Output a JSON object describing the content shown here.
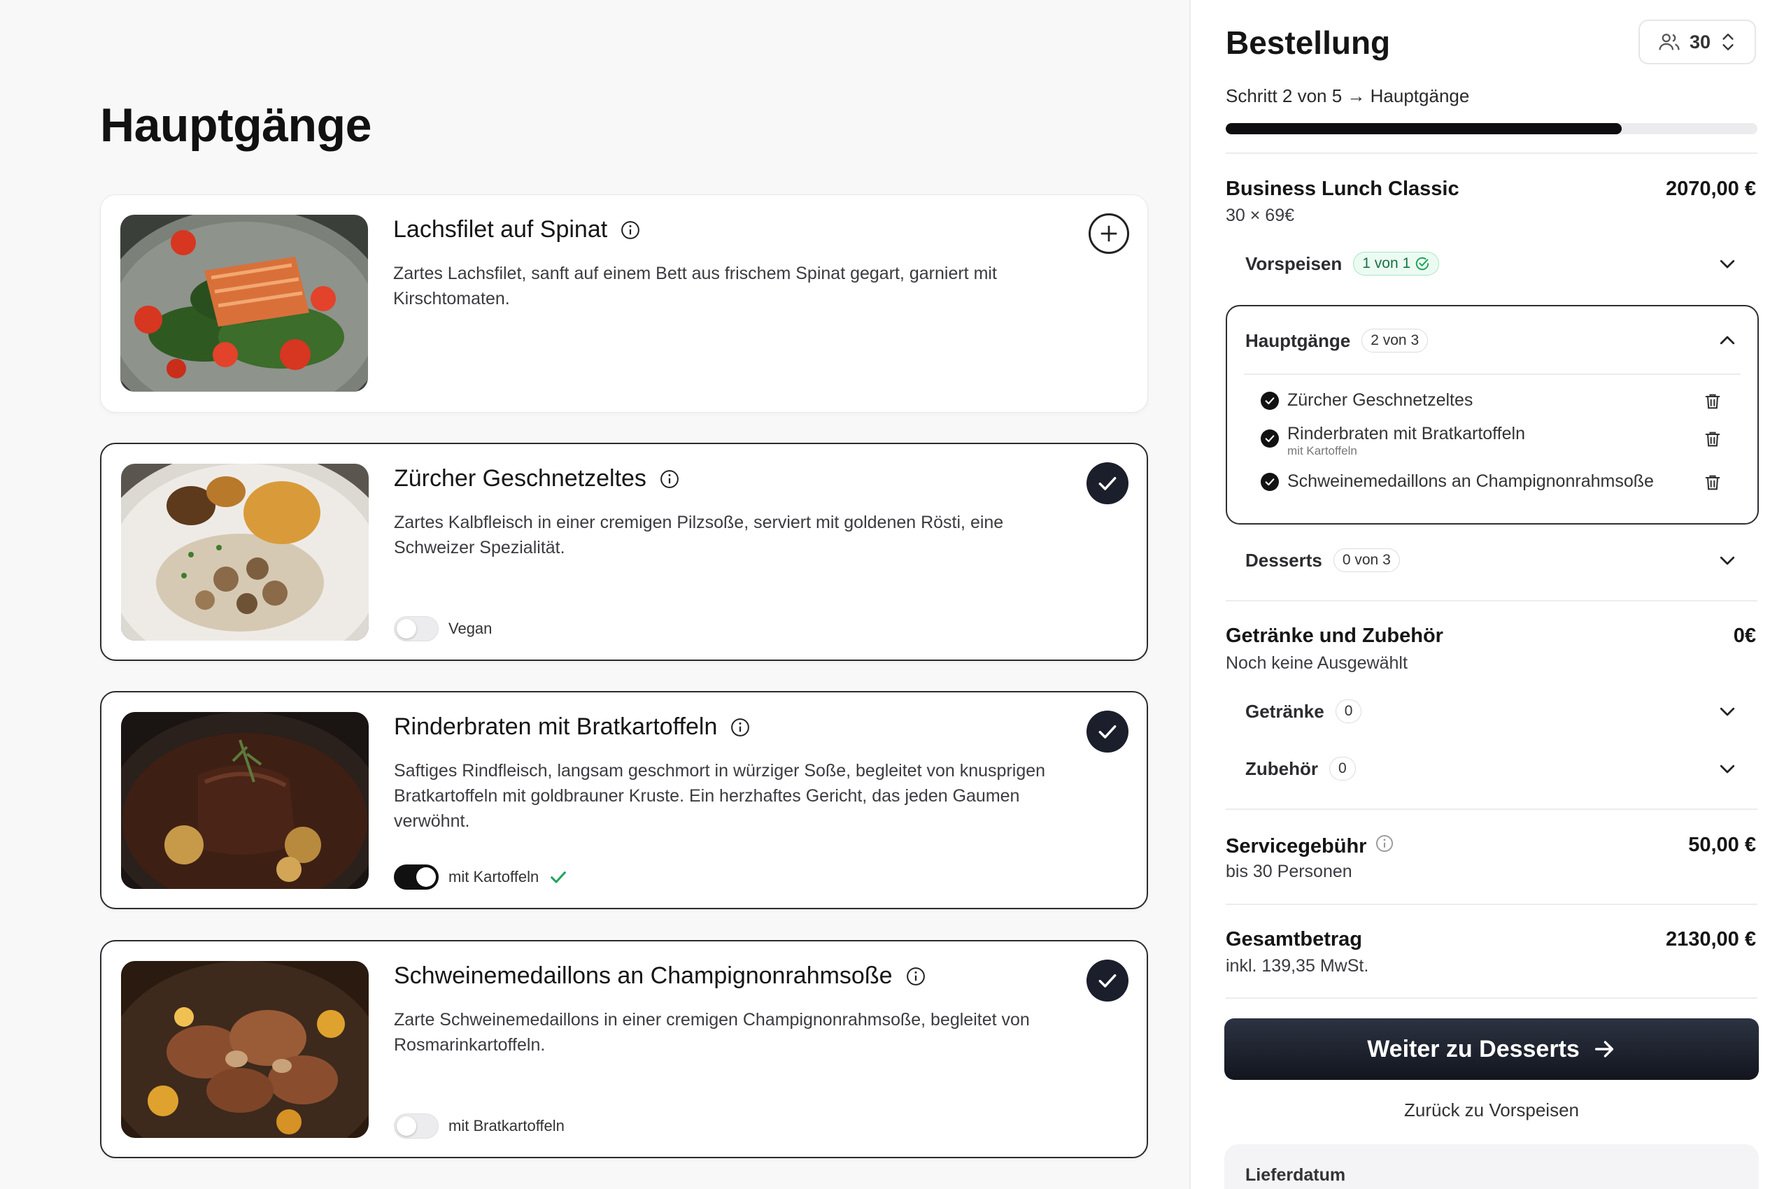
{
  "page": {
    "title": "Hauptgänge"
  },
  "dishes": [
    {
      "name": "Lachsfilet auf Spinat",
      "description": "Zartes Lachsfilet, sanft auf einem Bett aus frischem Spinat gegart, garniert mit Kirschtomaten.",
      "selected": false
    },
    {
      "name": "Zürcher Geschnetzeltes",
      "description": "Zartes Kalbfleisch in einer cremigen Pilzsoße, serviert mit goldenen Rösti, eine Schweizer Spezialität.",
      "selected": true,
      "option_label": "Vegan",
      "option_on": false
    },
    {
      "name": "Rinderbraten mit Bratkartoffeln",
      "description": "Saftiges Rindfleisch, langsam geschmort in würziger Soße, begleitet von knusprigen Bratkartoffeln mit goldbrauner Kruste. Ein herzhaftes Gericht, das jeden Gaumen verwöhnt.",
      "selected": true,
      "option_label": "mit Kartoffeln",
      "option_on": true
    },
    {
      "name": "Schweinemedaillons an Champignonrahmsoße",
      "description": "Zarte Schweinemedaillons in einer cremigen Champignonrahmsoße, begleitet von Rosmarinkartoffeln.",
      "selected": true,
      "option_label": "mit Bratkartoffeln",
      "option_on": false
    }
  ],
  "order": {
    "title": "Bestellung",
    "guests": "30",
    "step": "Schritt 2 von 5 → Hauptgänge",
    "progress_fraction": 0.745,
    "package": {
      "name": "Business Lunch Classic",
      "price": "2070,00 €",
      "detail": "30 × 69€"
    },
    "categories": {
      "vorspeisen": {
        "label": "Vorspeisen",
        "count": "1 von 1"
      },
      "hauptgaenge": {
        "label": "Hauptgänge",
        "count": "2 von 3",
        "items": [
          {
            "name": "Zürcher Geschnetzeltes",
            "note": ""
          },
          {
            "name": "Rinderbraten mit Bratkartoffeln",
            "note": "mit Kartoffeln"
          },
          {
            "name": "Schweinemedaillons an Champignonrahmsoße",
            "note": ""
          }
        ]
      },
      "desserts": {
        "label": "Desserts",
        "count": "0 von 3"
      }
    },
    "extras": {
      "title": "Getränke und Zubehör",
      "price": "0€",
      "subtitle": "Noch keine Ausgewählt",
      "getraenke": {
        "label": "Getränke",
        "count": "0"
      },
      "zubehoer": {
        "label": "Zubehör",
        "count": "0"
      }
    },
    "service": {
      "title": "Servicegebühr",
      "price": "50,00 €",
      "subtitle": "bis 30 Personen"
    },
    "total": {
      "title": "Gesamtbetrag",
      "price": "2130,00 €",
      "subtitle": "inkl. 139,35 MwSt."
    },
    "next_button": "Weiter zu Desserts",
    "back_link": "Zurück zu Vorspeisen",
    "delivery_label": "Lieferdatum"
  },
  "colors": {
    "accent_dark": "#12151e",
    "success_green": "#22a45d",
    "border": "#ececef"
  }
}
